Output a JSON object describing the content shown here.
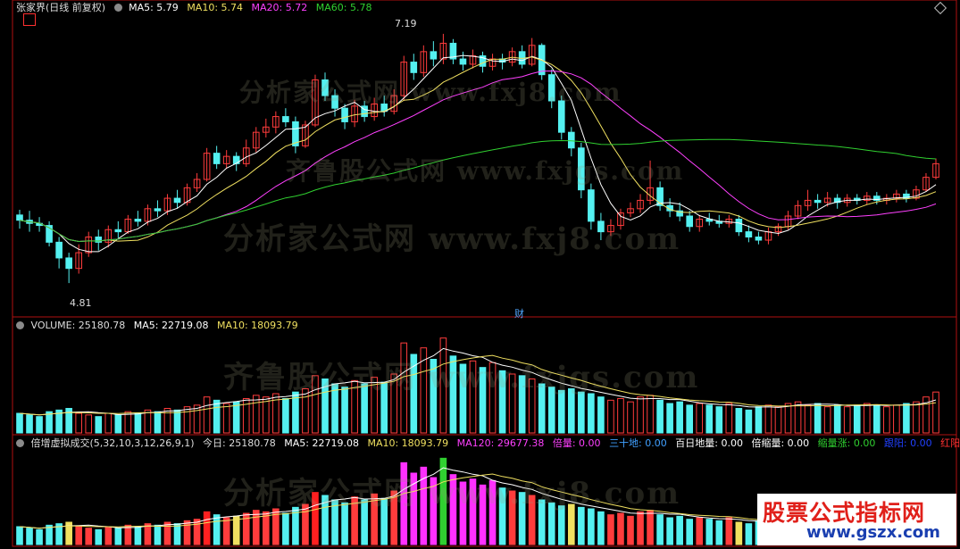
{
  "header": {
    "stock_name": "张家界",
    "period": "(日线 前复权)",
    "ma5": "MA5: 5.79",
    "ma10": "MA10: 5.74",
    "ma20": "MA20: 5.72",
    "ma60": "MA60: 5.78"
  },
  "price_marks": {
    "high": "7.19",
    "low": "4.81",
    "event": "财"
  },
  "volume": {
    "title": "VOLUME: 25180.78",
    "ma5": "MA5: 22719.08",
    "ma10": "MA10: 18093.79"
  },
  "indicator": {
    "title": "倍增虚拟成交(5,32,10,3,12,26,9,1)",
    "today": "今日: 25180.78",
    "ma5": "MA5: 22719.08",
    "ma10": "MA10: 18093.79",
    "ma120": "MA120: 29677.38",
    "beiliang": "倍量: 0.00",
    "sanshidi": "三十地: 0.00",
    "bairidi": "百日地量: 0.00",
    "beisuo": "倍缩量: 0.00",
    "suozhang": "缩量涨: 0.00",
    "yinyang": "跟阳: 0.00",
    "hongyang": "红阳"
  },
  "watermark": {
    "line1": "分析家公式网 www.fxj8.com",
    "line2": "齐鲁股公式网 www.fxjgs.com"
  },
  "logo": {
    "title": "股票公式指标网",
    "url": "www.gszx.com"
  },
  "colors": {
    "up": "#ff3c3c",
    "down": "#54f0f0",
    "ma5": "#ffffff",
    "ma10": "#f0e060",
    "ma20": "#ff40ff",
    "ma60": "#30d030",
    "divider": "#b01010"
  },
  "chart_data": {
    "type": "candlestick",
    "price_range": [
      4.81,
      7.19
    ],
    "candles": [
      [
        5.46,
        5.41,
        5.51,
        5.33
      ],
      [
        5.41,
        5.38,
        5.5,
        5.3
      ],
      [
        5.38,
        5.36,
        5.44,
        5.3
      ],
      [
        5.36,
        5.2,
        5.4,
        5.16
      ],
      [
        5.2,
        5.05,
        5.25,
        4.95
      ],
      [
        5.05,
        4.95,
        5.1,
        4.81
      ],
      [
        4.95,
        5.1,
        5.18,
        4.9
      ],
      [
        5.1,
        5.25,
        5.3,
        5.06
      ],
      [
        5.25,
        5.2,
        5.32,
        5.12
      ],
      [
        5.2,
        5.32,
        5.36,
        5.15
      ],
      [
        5.32,
        5.3,
        5.4,
        5.24
      ],
      [
        5.3,
        5.42,
        5.46,
        5.28
      ],
      [
        5.42,
        5.4,
        5.5,
        5.35
      ],
      [
        5.4,
        5.52,
        5.56,
        5.36
      ],
      [
        5.52,
        5.5,
        5.6,
        5.44
      ],
      [
        5.5,
        5.62,
        5.66,
        5.46
      ],
      [
        5.62,
        5.58,
        5.7,
        5.52
      ],
      [
        5.58,
        5.72,
        5.76,
        5.55
      ],
      [
        5.72,
        5.8,
        5.86,
        5.68
      ],
      [
        5.8,
        6.05,
        6.1,
        5.78
      ],
      [
        6.05,
        5.95,
        6.12,
        5.9
      ],
      [
        5.95,
        6.02,
        6.08,
        5.9
      ],
      [
        6.02,
        5.95,
        6.06,
        5.88
      ],
      [
        5.95,
        6.1,
        6.18,
        5.92
      ],
      [
        6.1,
        6.25,
        6.3,
        6.06
      ],
      [
        6.25,
        6.3,
        6.38,
        6.2
      ],
      [
        6.3,
        6.4,
        6.45,
        6.24
      ],
      [
        6.4,
        6.35,
        6.48,
        6.3
      ],
      [
        6.35,
        6.12,
        6.4,
        6.05
      ],
      [
        6.12,
        6.32,
        6.36,
        6.1
      ],
      [
        6.32,
        6.75,
        6.8,
        6.3
      ],
      [
        6.75,
        6.6,
        6.82,
        6.55
      ],
      [
        6.6,
        6.48,
        6.66,
        6.4
      ],
      [
        6.48,
        6.35,
        6.52,
        6.28
      ],
      [
        6.35,
        6.5,
        6.56,
        6.3
      ],
      [
        6.5,
        6.4,
        6.55,
        6.35
      ],
      [
        6.4,
        6.52,
        6.58,
        6.36
      ],
      [
        6.52,
        6.45,
        6.6,
        6.4
      ],
      [
        6.45,
        6.6,
        6.66,
        6.42
      ],
      [
        6.6,
        6.92,
        6.98,
        6.55
      ],
      [
        6.92,
        6.82,
        7.0,
        6.75
      ],
      [
        6.82,
        7.02,
        7.08,
        6.78
      ],
      [
        7.02,
        6.95,
        7.12,
        6.88
      ],
      [
        6.95,
        7.1,
        7.19,
        6.9
      ],
      [
        7.1,
        6.95,
        7.14,
        6.9
      ],
      [
        6.95,
        6.9,
        7.02,
        6.84
      ],
      [
        6.9,
        6.98,
        7.04,
        6.86
      ],
      [
        6.98,
        6.88,
        7.02,
        6.82
      ],
      [
        6.88,
        6.95,
        7.0,
        6.84
      ],
      [
        6.95,
        6.92,
        7.0,
        6.85
      ],
      [
        6.92,
        7.02,
        7.06,
        6.88
      ],
      [
        7.02,
        6.9,
        7.08,
        6.86
      ],
      [
        6.9,
        7.08,
        7.15,
        6.88
      ],
      [
        7.08,
        6.8,
        7.1,
        6.75
      ],
      [
        6.8,
        6.55,
        6.85,
        6.48
      ],
      [
        6.55,
        6.25,
        6.6,
        6.18
      ],
      [
        6.25,
        6.1,
        6.3,
        6.02
      ],
      [
        6.1,
        5.7,
        6.15,
        5.62
      ],
      [
        5.7,
        5.4,
        5.76,
        5.32
      ],
      [
        5.4,
        5.3,
        5.48,
        5.22
      ],
      [
        5.3,
        5.36,
        5.42,
        5.26
      ],
      [
        5.36,
        5.48,
        5.52,
        5.32
      ],
      [
        5.48,
        5.52,
        5.58,
        5.44
      ],
      [
        5.52,
        5.6,
        5.66,
        5.48
      ],
      [
        5.6,
        5.72,
        5.98,
        5.56
      ],
      [
        5.72,
        5.55,
        5.78,
        5.5
      ],
      [
        5.55,
        5.5,
        5.62,
        5.44
      ],
      [
        5.5,
        5.45,
        5.58,
        5.4
      ],
      [
        5.45,
        5.35,
        5.5,
        5.3
      ],
      [
        5.35,
        5.42,
        5.46,
        5.3
      ],
      [
        5.42,
        5.4,
        5.48,
        5.36
      ],
      [
        5.4,
        5.38,
        5.46,
        5.34
      ],
      [
        5.38,
        5.42,
        5.46,
        5.34
      ],
      [
        5.42,
        5.3,
        5.46,
        5.26
      ],
      [
        5.3,
        5.25,
        5.36,
        5.2
      ],
      [
        5.25,
        5.22,
        5.3,
        5.18
      ],
      [
        5.22,
        5.3,
        5.34,
        5.18
      ],
      [
        5.3,
        5.35,
        5.38,
        5.26
      ],
      [
        5.35,
        5.45,
        5.5,
        5.32
      ],
      [
        5.45,
        5.55,
        5.6,
        5.42
      ],
      [
        5.55,
        5.6,
        5.7,
        5.5
      ],
      [
        5.6,
        5.58,
        5.66,
        5.52
      ],
      [
        5.58,
        5.62,
        5.68,
        5.54
      ],
      [
        5.62,
        5.58,
        5.66,
        5.52
      ],
      [
        5.58,
        5.62,
        5.66,
        5.54
      ],
      [
        5.62,
        5.6,
        5.66,
        5.56
      ],
      [
        5.6,
        5.64,
        5.68,
        5.56
      ],
      [
        5.64,
        5.6,
        5.68,
        5.56
      ],
      [
        5.6,
        5.62,
        5.66,
        5.56
      ],
      [
        5.62,
        5.66,
        5.7,
        5.58
      ],
      [
        5.66,
        5.62,
        5.7,
        5.58
      ],
      [
        5.62,
        5.7,
        5.74,
        5.6
      ],
      [
        5.7,
        5.82,
        5.86,
        5.68
      ],
      [
        5.82,
        5.95,
        6.0,
        5.8
      ]
    ],
    "volume": [
      12,
      11,
      10,
      13,
      14,
      15,
      12,
      11,
      10,
      12,
      11,
      13,
      12,
      14,
      13,
      15,
      14,
      16,
      17,
      22,
      20,
      18,
      19,
      21,
      23,
      22,
      24,
      21,
      25,
      27,
      35,
      33,
      30,
      28,
      32,
      30,
      34,
      31,
      36,
      55,
      48,
      52,
      45,
      58,
      47,
      42,
      44,
      40,
      43,
      38,
      36,
      35,
      33,
      30,
      28,
      26,
      27,
      25,
      24,
      22,
      20,
      21,
      19,
      22,
      23,
      20,
      18,
      19,
      17,
      18,
      17,
      16,
      18,
      15,
      14,
      16,
      17,
      16,
      18,
      19,
      17,
      18,
      16,
      17,
      16,
      17,
      18,
      17,
      16,
      17,
      18,
      19,
      22,
      25
    ],
    "volume_range": [
      0,
      60
    ]
  }
}
